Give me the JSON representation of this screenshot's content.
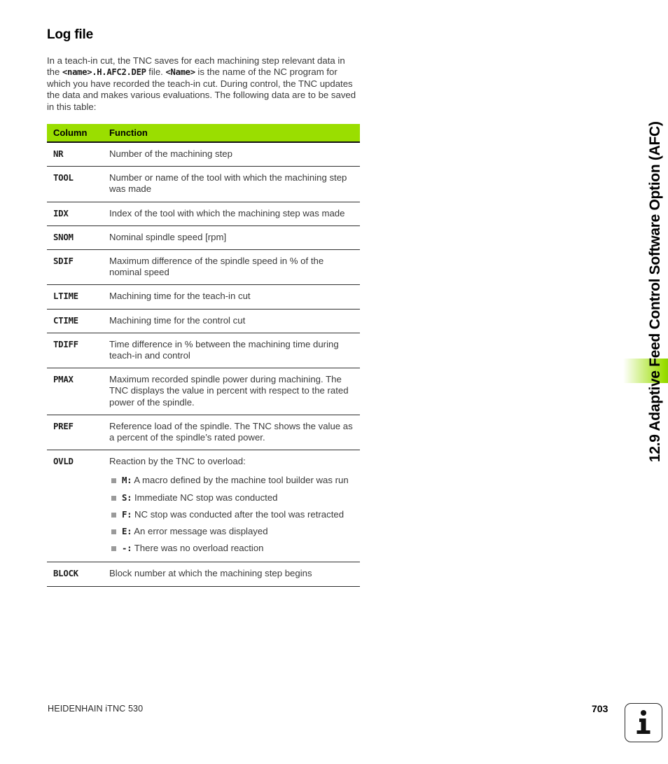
{
  "heading": "Log file",
  "intro": {
    "part1": "In a teach-in cut, the TNC saves for each machining step relevant data in the ",
    "code1": "<name>.H.AFC2.DEP",
    "part2": " file. ",
    "code2": "<Name>",
    "part3": " is the name of the NC program for which you have recorded the teach-in cut. During control, the TNC updates the data and makes various evaluations. The following data are to be saved in this table:"
  },
  "table": {
    "headers": {
      "column": "Column",
      "function": "Function"
    },
    "rows": [
      {
        "key": "NR",
        "text": "Number of the machining step"
      },
      {
        "key": "TOOL",
        "text": "Number or name of the tool with which the machining step was made"
      },
      {
        "key": "IDX",
        "text": "Index of the tool with which the machining step was made"
      },
      {
        "key": "SNOM",
        "text": "Nominal spindle speed [rpm]"
      },
      {
        "key": "SDIF",
        "text": "Maximum difference of the spindle speed in % of the nominal speed"
      },
      {
        "key": "LTIME",
        "text": "Machining time for the teach-in cut"
      },
      {
        "key": "CTIME",
        "text": "Machining time for the control cut"
      },
      {
        "key": "TDIFF",
        "text": "Time difference in % between the machining time during teach-in and control"
      },
      {
        "key": "PMAX",
        "text": "Maximum recorded spindle power during machining. The TNC displays the value in percent with respect to the rated power of the spindle."
      },
      {
        "key": "PREF",
        "text": "Reference load of the spindle. The TNC shows the value as a percent of the spindle’s rated power."
      },
      {
        "key": "OVLD",
        "text": "Reaction by the TNC to overload:",
        "bullets": [
          {
            "code": "M:",
            "text": " A macro defined by the machine tool builder was run"
          },
          {
            "code": "S:",
            "text": " Immediate NC stop was conducted"
          },
          {
            "code": "F:",
            "text": " NC stop was conducted after the tool was retracted"
          },
          {
            "code": "E:",
            "text": " An error message was displayed"
          },
          {
            "code": "-:",
            "text": " There was no overload reaction"
          }
        ]
      },
      {
        "key": "BLOCK",
        "text": "Block number at which the machining step begins"
      }
    ]
  },
  "side_title": "12.9 Adaptive Feed Control Software Option (AFC)",
  "footer": {
    "product": "HEIDENHAIN iTNC 530",
    "page_number": "703",
    "info_icon": "info-icon"
  },
  "colors": {
    "accent_green": "#9ade00",
    "body_text": "#3a3a3a",
    "rule": "#2f2f2f",
    "bullet": "#9a9a9a"
  }
}
